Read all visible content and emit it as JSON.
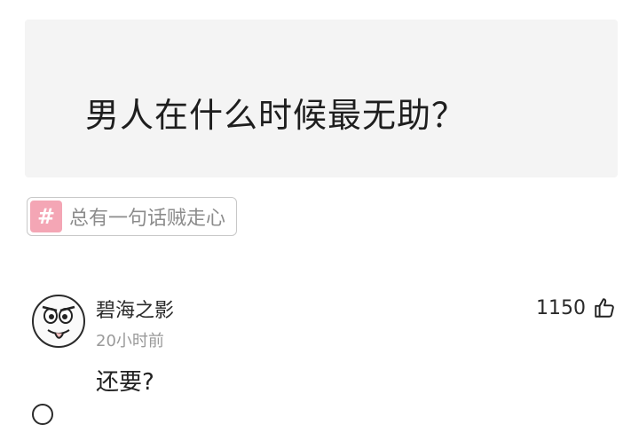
{
  "question": {
    "title": "男人在什么时候最无助？"
  },
  "topic": {
    "icon": "hash-icon",
    "icon_glyph": "#",
    "label": "总有一句话贼走心",
    "icon_color": "#f4a6b5"
  },
  "comment": {
    "username": "碧海之影",
    "time": "20小时前",
    "text": "还要?",
    "likes": "1150",
    "like_icon": "thumbs-up-icon"
  }
}
